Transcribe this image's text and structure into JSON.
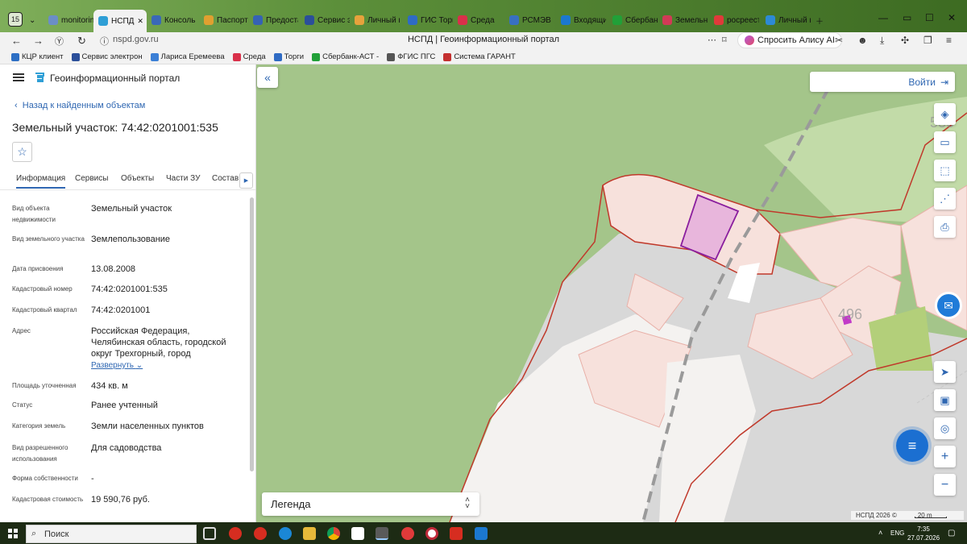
{
  "browser": {
    "tab_count": "15",
    "tabs": [
      {
        "label": "monitorin",
        "color": "#6b8ec7"
      },
      {
        "label": "НСПД",
        "color": "#2f9fd6",
        "active": true
      },
      {
        "label": "Консоль",
        "color": "#3a68b8"
      },
      {
        "label": "Паспорт",
        "color": "#e0a030"
      },
      {
        "label": "Предоста",
        "color": "#3562b5"
      },
      {
        "label": "Сервис э",
        "color": "#2b4f9a"
      },
      {
        "label": "Личный к",
        "color": "#e6a23c"
      },
      {
        "label": "ГИС Торг",
        "color": "#2f6bc4"
      },
      {
        "label": "Среда",
        "color": "#d9304a"
      },
      {
        "label": "РСМЭВ",
        "color": "#3870c0"
      },
      {
        "label": "Входящи",
        "color": "#1b78d0"
      },
      {
        "label": "Сбербанк",
        "color": "#21a038"
      },
      {
        "label": "Земельн",
        "color": "#d23a56"
      },
      {
        "label": "росреест",
        "color": "#e03a3a"
      },
      {
        "label": "Личный к",
        "color": "#2d8ad6"
      }
    ],
    "url": "nspd.gov.ru",
    "page_title": "НСПД | Геоинформационный портал",
    "alice_label": "Спросить Алису AI",
    "bookmarks": [
      {
        "label": "КЦР клиент",
        "color": "#2d6fc4"
      },
      {
        "label": "Сервис электрон",
        "color": "#2b4f9a"
      },
      {
        "label": "Лариса Еремеева",
        "color": "#3b7fd6"
      },
      {
        "label": "Среда",
        "color": "#d9304a"
      },
      {
        "label": "Торги",
        "color": "#2f6bc4"
      },
      {
        "label": "Сбербанк-АСТ - ",
        "color": "#21a038"
      },
      {
        "label": "ФГИС ПГС",
        "color": "#555555"
      },
      {
        "label": "Система ГАРАНТ",
        "color": "#c43030"
      }
    ]
  },
  "panel": {
    "app_title": "Геоинформационный портал",
    "back_link": "Назад к найденным объектам",
    "object_title": "Земельный участок: 74:42:0201001:535",
    "tabs": [
      "Информация",
      "Сервисы",
      "Объекты",
      "Части ЗУ",
      "Состав"
    ],
    "fields": [
      {
        "label": "Вид объекта недвижимости",
        "value": "Земельный участок"
      },
      {
        "label": "Вид земельного участка",
        "value": "Землепользование"
      },
      {
        "label": "Дата присвоения",
        "value": "13.08.2008"
      },
      {
        "label": "Кадастровый номер",
        "value": "74:42:0201001:535"
      },
      {
        "label": "Кадастровый квартал",
        "value": "74:42:0201001"
      },
      {
        "label": "Адрес",
        "value": "Российская Федерация, Челябинская область, городской округ Трехгорный, город"
      },
      {
        "label": "Площадь уточненная",
        "value": "434 кв. м"
      },
      {
        "label": "Статус",
        "value": "Ранее учтенный"
      },
      {
        "label": "Категория земель",
        "value": "Земли населенных пунктов"
      },
      {
        "label": "Вид разрешенного использования",
        "value": "Для садоводства"
      },
      {
        "label": "Форма собственности",
        "value": "-"
      },
      {
        "label": "Кадастровая стоимость",
        "value": "19 590,76 руб."
      }
    ],
    "expand_label": "Развернуть"
  },
  "map": {
    "login_label": "Войти",
    "parcel_label": "496",
    "parcel_label_top": "536",
    "legend_label": "Легенда",
    "attribution": "НСПД 2026 ©",
    "scale": "20 m",
    "colors": {
      "grass": "#a4c58a",
      "road": "#d8d8d8",
      "parcel": "#f7e1dc",
      "border": "#c0392b",
      "selected": "#e8b6dc",
      "selected_border": "#8a1e9e"
    }
  },
  "taskbar": {
    "search_placeholder": "Поиск",
    "lang": "ENG",
    "time": "7:35",
    "date": "27.07.2026"
  }
}
